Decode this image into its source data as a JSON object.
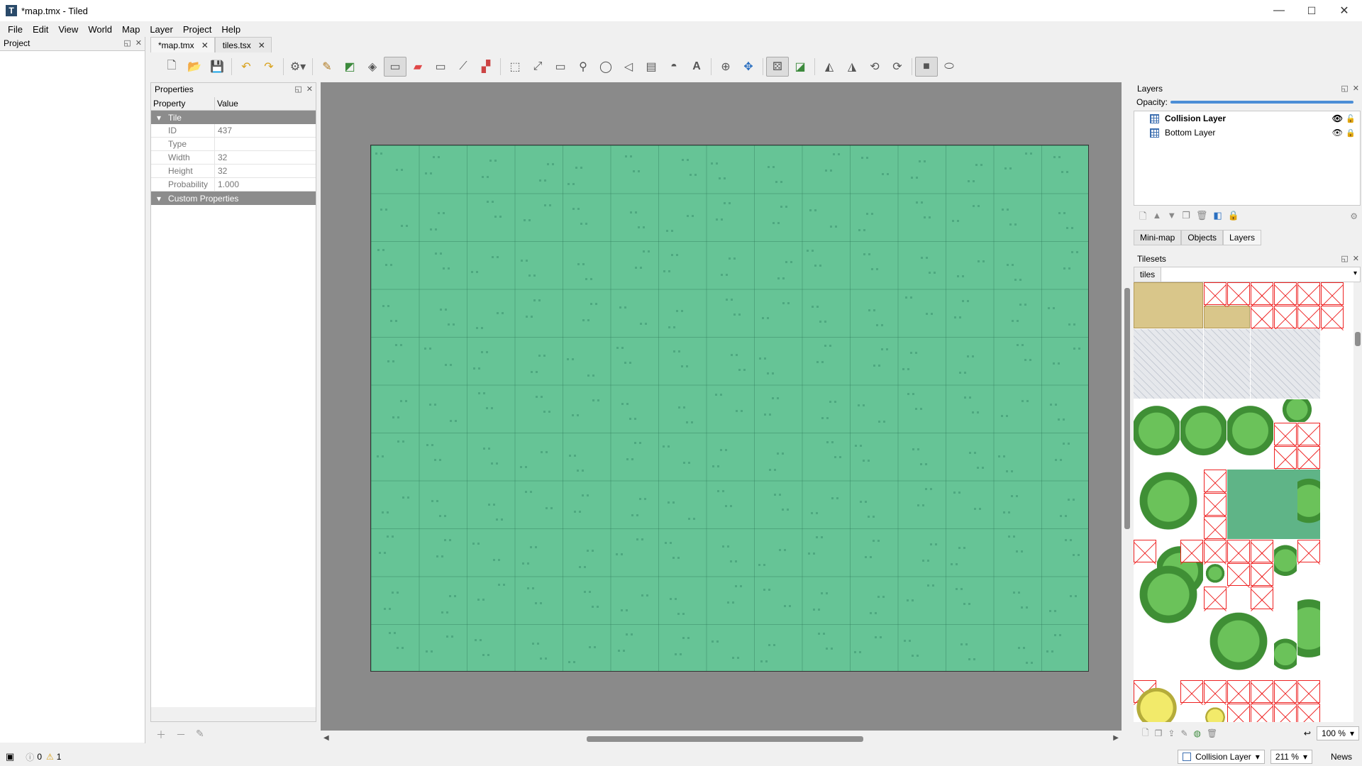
{
  "window": {
    "title": "*map.tmx - Tiled",
    "minimize": "—",
    "maximize": "☐",
    "close": "✕"
  },
  "menu": [
    "File",
    "Edit",
    "View",
    "World",
    "Map",
    "Layer",
    "Project",
    "Help"
  ],
  "project_dock": {
    "title": "Project"
  },
  "tabs": [
    {
      "label": "*map.tmx"
    },
    {
      "label": "tiles.tsx"
    }
  ],
  "properties": {
    "title": "Properties",
    "col_property": "Property",
    "col_value": "Value",
    "group_tile": "Tile",
    "rows": [
      {
        "key": "ID",
        "value": "437"
      },
      {
        "key": "Type",
        "value": ""
      },
      {
        "key": "Width",
        "value": "32"
      },
      {
        "key": "Height",
        "value": "32"
      },
      {
        "key": "Probability",
        "value": "1.000"
      }
    ],
    "group_custom": "Custom Properties"
  },
  "layers": {
    "title": "Layers",
    "opacity_label": "Opacity:",
    "opacity": 1.0,
    "items": [
      {
        "name": "Collision Layer",
        "selected": true,
        "visible": true,
        "locked": false
      },
      {
        "name": "Bottom Layer",
        "selected": false,
        "visible": true,
        "locked": true
      }
    ]
  },
  "dock_tabs": [
    "Mini-map",
    "Objects",
    "Layers"
  ],
  "tilesets": {
    "title": "Tilesets",
    "active": "tiles",
    "zoom": "100 %"
  },
  "status": {
    "errors": "0",
    "warnings": "1",
    "layer": "Collision Layer",
    "zoom": "211 %",
    "news": "News"
  },
  "colors": {
    "map_background": "#66c496",
    "canvas_background": "#8a8a8a",
    "accent": "#4c8ed6"
  }
}
